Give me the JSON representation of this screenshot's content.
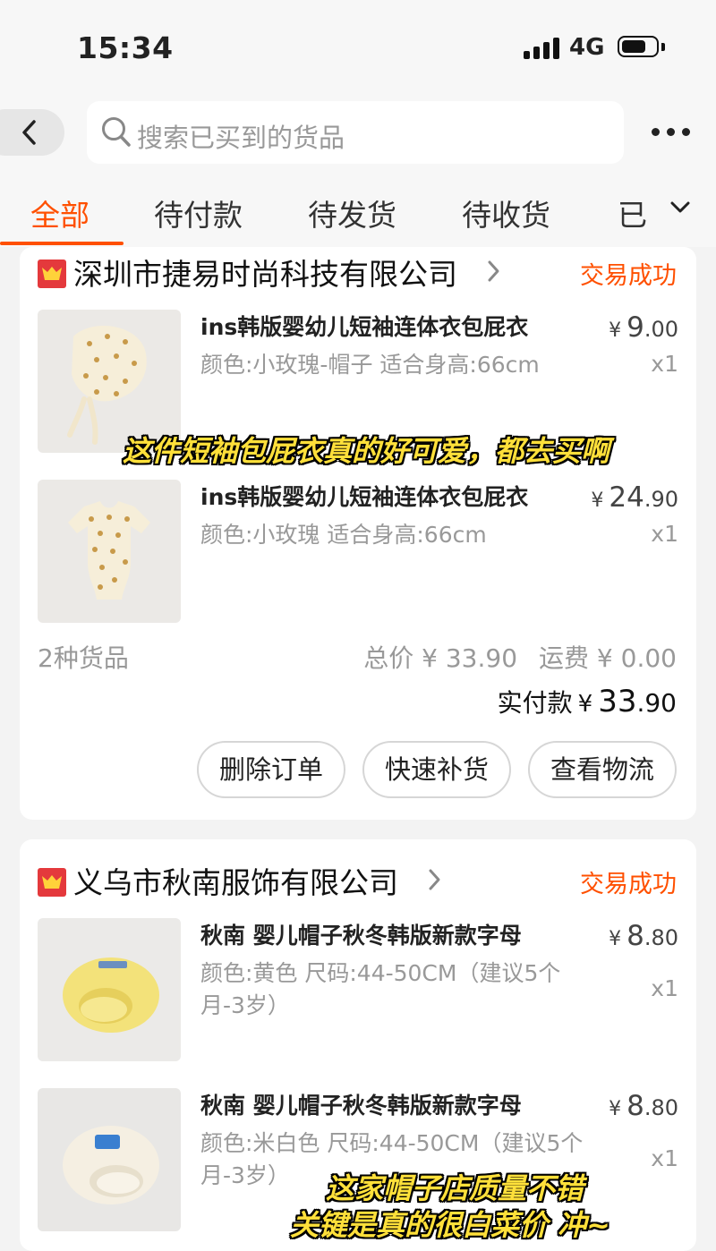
{
  "status_bar": {
    "time": "15:34",
    "network": "4G"
  },
  "search": {
    "placeholder": "搜索已买到的货品"
  },
  "tabs": [
    {
      "label": "全部",
      "active": true
    },
    {
      "label": "待付款"
    },
    {
      "label": "待发货"
    },
    {
      "label": "待收货"
    },
    {
      "label": "已"
    }
  ],
  "orders": [
    {
      "shop": "深圳市捷易时尚科技有限公司",
      "status": "交易成功",
      "items": [
        {
          "title": "ins韩版婴幼儿短袖连体衣包屁衣",
          "spec": "颜色:小玫瑰-帽子  适合身高:66cm",
          "price_int": "9",
          "price_dec": ".00",
          "qty": "x1"
        },
        {
          "title": "ins韩版婴幼儿短袖连体衣包屁衣",
          "spec": "颜色:小玫瑰  适合身高:66cm",
          "price_int": "24",
          "price_dec": ".90",
          "qty": "x1"
        }
      ],
      "count": "2种货品",
      "total": "总价 ¥ 33.90",
      "shipping": "运费 ¥ 0.00",
      "paid_label": "实付款",
      "paid_int": "33",
      "paid_dec": ".90",
      "actions": [
        "删除订单",
        "快速补货",
        "查看物流"
      ]
    },
    {
      "shop": "义乌市秋南服饰有限公司",
      "status": "交易成功",
      "items": [
        {
          "title": "秋南 婴儿帽子秋冬韩版新款字母",
          "spec": "颜色:黄色  尺码:44-50CM（建议5个月-3岁）",
          "price_int": "8",
          "price_dec": ".80",
          "qty": "x1"
        },
        {
          "title": "秋南 婴儿帽子秋冬韩版新款字母",
          "spec": "颜色:米白色  尺码:44-50CM（建议5个月-3岁）",
          "price_int": "8",
          "price_dec": ".80",
          "qty": "x1"
        }
      ]
    }
  ],
  "currency": "¥",
  "captions": {
    "caption1": "这件短袖包屁衣真的好可爱，都去买啊",
    "caption2_line1": "这家帽子店质量不错",
    "caption2_line2": "关键是真的很白菜价 冲~"
  },
  "colors": {
    "accent": "#ff5000",
    "caption": "#ffe03a"
  }
}
